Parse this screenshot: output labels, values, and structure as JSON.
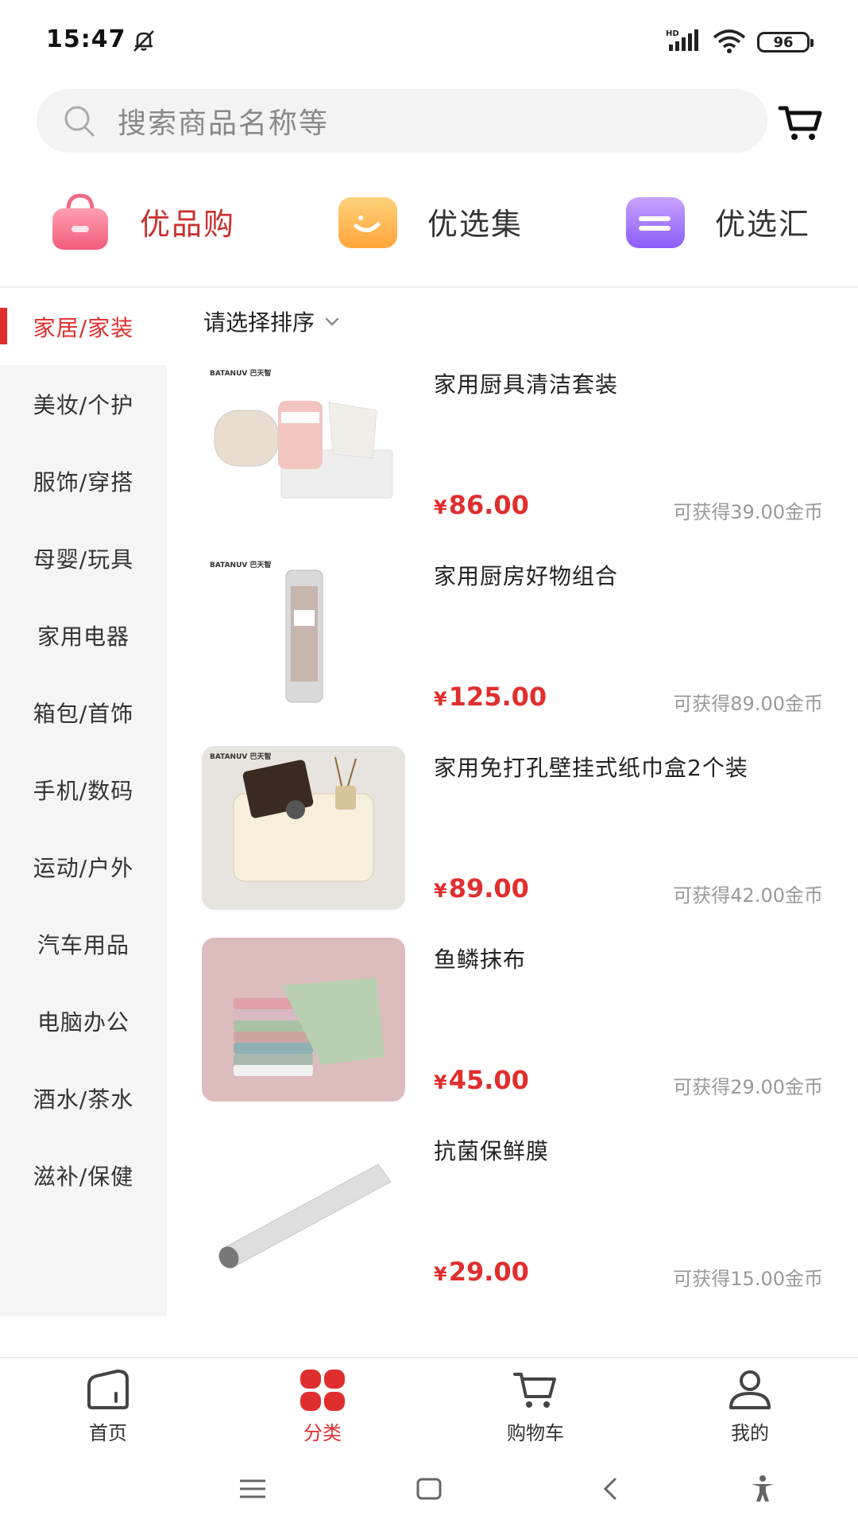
{
  "status_bar": {
    "time": "15:47",
    "battery": "96"
  },
  "search": {
    "placeholder": "搜索商品名称等"
  },
  "promos": [
    {
      "label": "优品购",
      "color": "#c9302c"
    },
    {
      "label": "优选集",
      "color": "#333333"
    },
    {
      "label": "优选汇",
      "color": "#333333"
    }
  ],
  "sidebar": {
    "items": [
      {
        "label": "家居/家装",
        "active": true
      },
      {
        "label": "美妆/个护"
      },
      {
        "label": "服饰/穿搭"
      },
      {
        "label": "母婴/玩具"
      },
      {
        "label": "家用电器"
      },
      {
        "label": "箱包/首饰"
      },
      {
        "label": "手机/数码"
      },
      {
        "label": "运动/户外"
      },
      {
        "label": "汽车用品"
      },
      {
        "label": "电脑办公"
      },
      {
        "label": "酒水/茶水"
      },
      {
        "label": "滋补/保健"
      }
    ]
  },
  "sort": {
    "label": "请选择排序"
  },
  "currency": "¥",
  "products": [
    {
      "name": "家用厨具清洁套装",
      "price": "86.00",
      "coins": "可获得39.00金币"
    },
    {
      "name": "家用厨房好物组合",
      "price": "125.00",
      "coins": "可获得89.00金币"
    },
    {
      "name": "家用免打孔壁挂式纸巾盒2个装",
      "price": "89.00",
      "coins": "可获得42.00金币"
    },
    {
      "name": "鱼鳞抹布",
      "price": "45.00",
      "coins": "可获得29.00金币"
    },
    {
      "name": "抗菌保鲜膜",
      "price": "29.00",
      "coins": "可获得15.00金币"
    }
  ],
  "bottom_nav": {
    "items": [
      {
        "label": "首页"
      },
      {
        "label": "分类",
        "active": true
      },
      {
        "label": "购物车"
      },
      {
        "label": "我的"
      }
    ]
  },
  "colors": {
    "accent": "#e02e2e"
  }
}
